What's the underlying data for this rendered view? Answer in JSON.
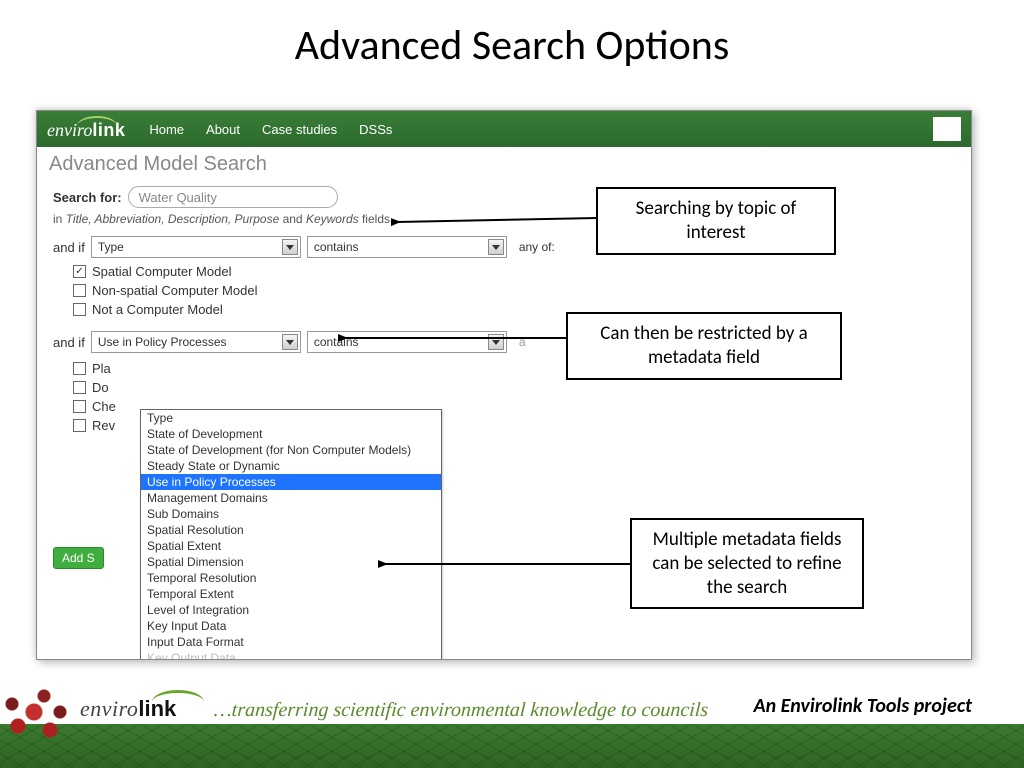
{
  "slide": {
    "title": "Advanced Search Options",
    "footer_tagline": "…transferring scientific environmental knowledge to councils",
    "footer_right": "An Envirolink Tools project",
    "logo_enviro": "enviro",
    "logo_link": "link"
  },
  "callouts": {
    "c1": "Searching by topic of interest",
    "c2": "Can then be restricted by a metadata field",
    "c3": "Multiple metadata fields can be selected to refine the search"
  },
  "app": {
    "nav": {
      "home": "Home",
      "about": "About",
      "case": "Case studies",
      "dsss": "DSSs"
    },
    "subheader": "Advanced Model Search",
    "search_label": "Search for:",
    "search_value": "Water Quality",
    "search_hint_prefix": "in ",
    "search_hint_fields": "Title, Abbreviation, Description, Purpose",
    "search_hint_and": " and ",
    "search_hint_last": "Keywords",
    "search_hint_suffix": " fields",
    "and_if": "and if",
    "sel_type": "Type",
    "sel_contains": "contains",
    "any_of": "any of:",
    "type_opts": {
      "o1": {
        "label": "Spatial Computer Model",
        "checked": true
      },
      "o2": {
        "label": "Non-spatial Computer Model",
        "checked": false
      },
      "o3": {
        "label": "Not a Computer Model",
        "checked": false
      }
    },
    "sel2_value": "Use in Policy Processes",
    "policy_opts": {
      "p1": {
        "label": "Pla",
        "checked": false
      },
      "p2": {
        "label": "Do",
        "checked": false
      },
      "p3": {
        "label": "Che",
        "checked": false
      },
      "p4": {
        "label": "Rev",
        "checked": false
      }
    },
    "add_button": "Add S",
    "dropdown": {
      "i0": "Type",
      "i1": "State of Development",
      "i2": "State of Development (for Non Computer Models)",
      "i3": "Steady State or Dynamic",
      "i4": "Use in Policy Processes",
      "i5": "Management Domains",
      "i6": "Sub Domains",
      "i7": "Spatial Resolution",
      "i8": "Spatial Extent",
      "i9": "Spatial Dimension",
      "i10": "Temporal Resolution",
      "i11": "Temporal Extent",
      "i12": "Level of Integration",
      "i13": "Key Input Data",
      "i14": "Input Data Format",
      "i15": "Key Output Data"
    }
  }
}
